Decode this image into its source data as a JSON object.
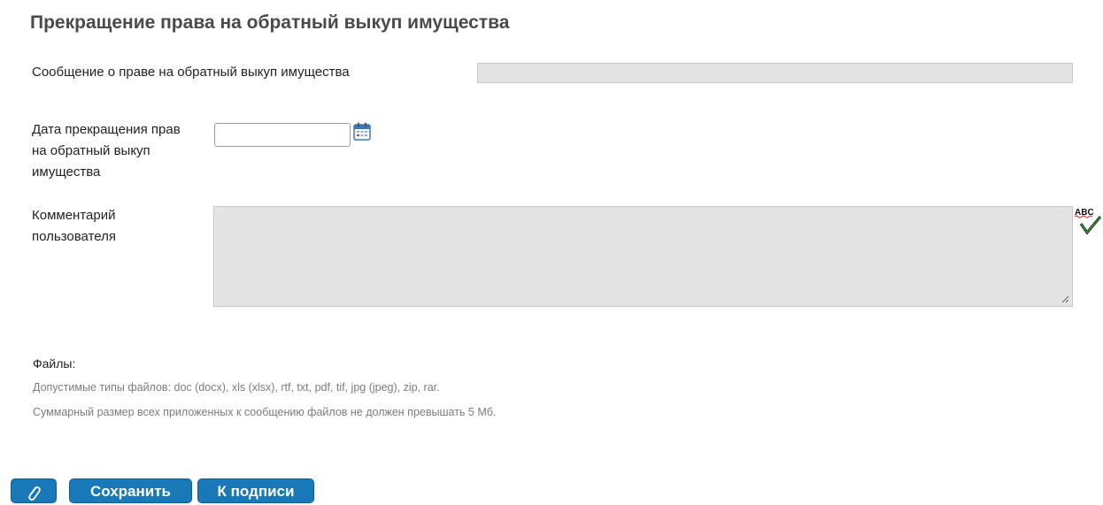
{
  "page": {
    "title": "Прекращение права на обратный выкуп имущества"
  },
  "form": {
    "message_label": "Сообщение о праве на обратный выкуп имущества",
    "date_label_lines": [
      "Дата прекращения прав",
      "на обратный выкуп",
      "имущества"
    ],
    "comment_label_lines": [
      "Комментарий",
      "пользователя"
    ],
    "date_value": "",
    "comment_value": ""
  },
  "files": {
    "heading": "Файлы:",
    "allowed_types": "Допустимые типы файлов: doc (docx), xls (xlsx), rtf, txt, pdf, tif, jpg (jpeg), zip, rar.",
    "size_limit": "Суммарный размер всех приложенных к сообщению файлов не должен превышать 5 Мб."
  },
  "buttons": {
    "save": "Сохранить",
    "sign": "К подписи"
  },
  "icons": {
    "calendar": "calendar-icon",
    "spellcheck": "spellcheck-icon",
    "attach": "paperclip-icon"
  },
  "spellcheck_text": "ABC",
  "colors": {
    "accent": "#1979b8",
    "field_gray": "#e4e4e4",
    "title": "#4a4a4a",
    "hint": "#7c7c7c"
  }
}
